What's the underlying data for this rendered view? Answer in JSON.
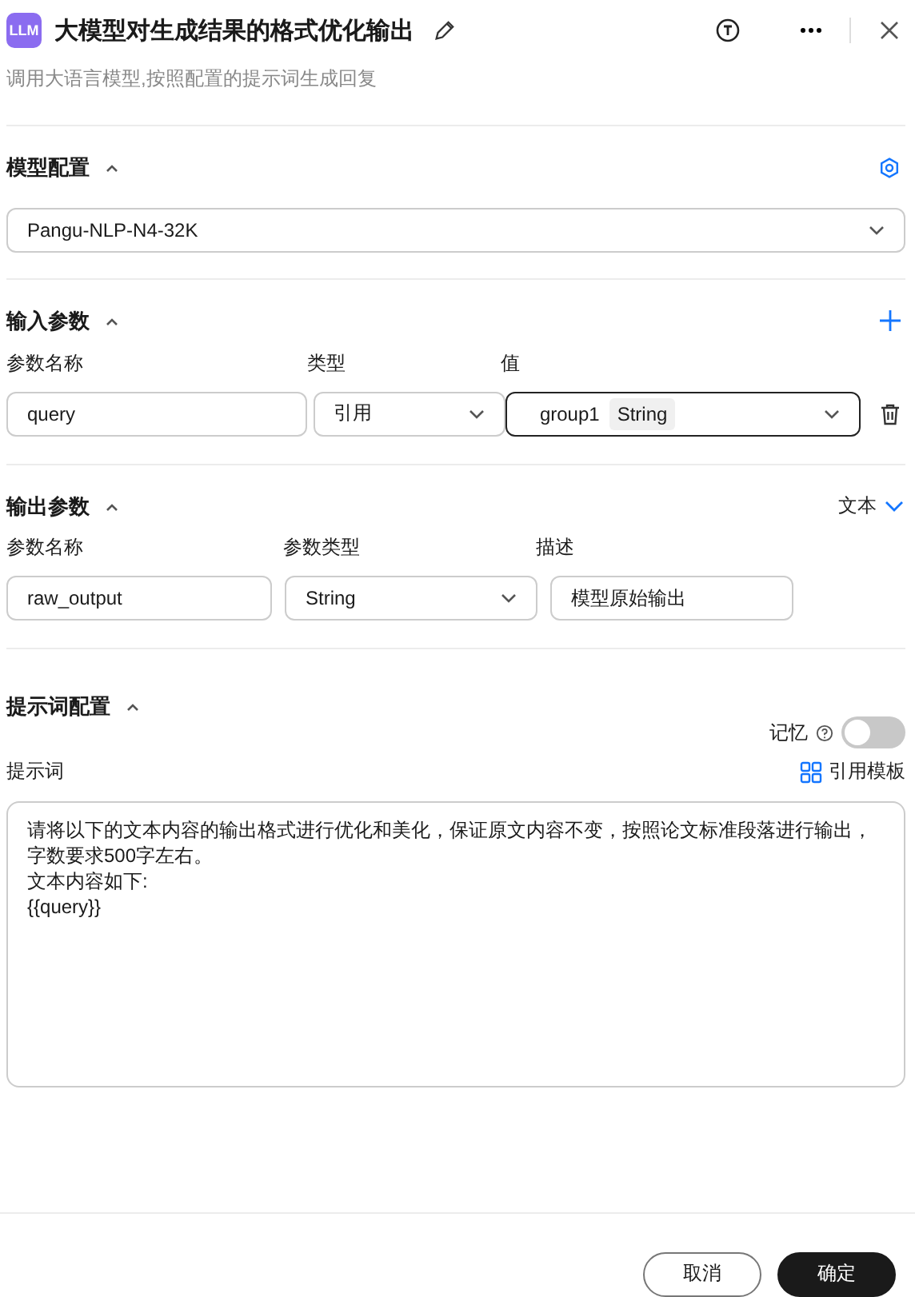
{
  "header": {
    "logo": "LLM",
    "title": "大模型对生成结果的格式优化输出",
    "subtitle": "调用大语言模型,按照配置的提示词生成回复"
  },
  "model_config": {
    "title": "模型配置",
    "expanded": true,
    "model": "Pangu-NLP-N4-32K"
  },
  "input_params": {
    "title": "输入参数",
    "expanded": true,
    "columns": [
      "参数名称",
      "类型",
      "值"
    ],
    "rows": [
      {
        "name": "query",
        "type": "引用",
        "value": "group1",
        "value_tag": "String"
      }
    ]
  },
  "output_params": {
    "title": "输出参数",
    "expanded": true,
    "format": "文本",
    "columns": [
      "参数名称",
      "参数类型",
      "描述"
    ],
    "rows": [
      {
        "name": "raw_output",
        "type": "String",
        "description": "模型原始输出"
      }
    ]
  },
  "prompt_config": {
    "title": "提示词配置",
    "expanded": true,
    "memory_label": "记忆",
    "memory_on": false,
    "prompt_label": "提示词",
    "template_link": "引用模板",
    "prompt_lines": [
      "请将以下的文本内容的输出格式进行优化和美化，保证原文内容不变，按照论文标准段落进行输出，",
      "字数要求500字左右。",
      "文本内容如下:",
      "{{query}}"
    ]
  },
  "footer": {
    "cancel": "取消",
    "confirm": "确定"
  }
}
